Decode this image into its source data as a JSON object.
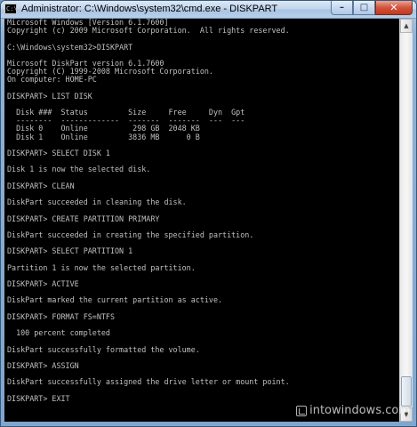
{
  "window": {
    "title": "Administrator: C:\\Windows\\system32\\cmd.exe - DISKPART",
    "icon_label": "C:\\",
    "minimize_icon": "minimize-icon",
    "maximize_icon": "maximize-icon",
    "close_icon": "close-icon",
    "minimize_glyph": "–",
    "maximize_glyph": "□",
    "close_glyph": "✕"
  },
  "console": {
    "lines": [
      "Microsoft Windows [Version 6.1.7600]",
      "Copyright (c) 2009 Microsoft Corporation.  All rights reserved.",
      "",
      "C:\\Windows\\system32>DISKPART",
      "",
      "Microsoft DiskPart version 6.1.7600",
      "Copyright (C) 1999-2008 Microsoft Corporation.",
      "On computer: HOME-PC",
      "",
      "DISKPART> LIST DISK",
      "",
      "  Disk ###  Status         Size     Free     Dyn  Gpt",
      "  --------  -------------  -------  -------  ---  ---",
      "  Disk 0    Online          298 GB  2048 KB",
      "  Disk 1    Online         3836 MB      0 B",
      "",
      "DISKPART> SELECT DISK 1",
      "",
      "Disk 1 is now the selected disk.",
      "",
      "DISKPART> CLEAN",
      "",
      "DiskPart succeeded in cleaning the disk.",
      "",
      "DISKPART> CREATE PARTITION PRIMARY",
      "",
      "DiskPart succeeded in creating the specified partition.",
      "",
      "DISKPART> SELECT PARTITION 1",
      "",
      "Partition 1 is now the selected partition.",
      "",
      "DISKPART> ACTIVE",
      "",
      "DiskPart marked the current partition as active.",
      "",
      "DISKPART> FORMAT FS=NTFS",
      "",
      "  100 percent completed",
      "",
      "DiskPart successfully formatted the volume.",
      "",
      "DISKPART> ASSIGN",
      "",
      "DiskPart successfully assigned the drive letter or mount point.",
      "",
      "DISKPART> EXIT",
      ""
    ]
  },
  "scrollbar": {
    "up_glyph": "▲",
    "down_glyph": "▼"
  },
  "watermark": {
    "text": "intowindows.com"
  },
  "colors": {
    "console_bg": "#000000",
    "console_fg": "#c0c0c0",
    "close_button": "#c03a20"
  }
}
